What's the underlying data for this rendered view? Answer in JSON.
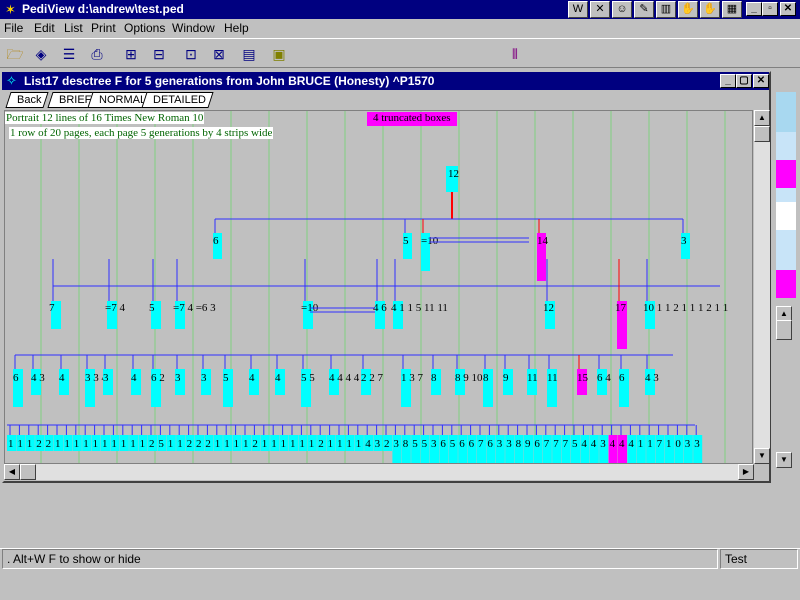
{
  "app": {
    "title": "PediView d:\\andrew\\test.ped"
  },
  "title_icons": [
    "W",
    "✕",
    "☺",
    "✎",
    "▥",
    "✋",
    "✋",
    "▦"
  ],
  "menu": [
    "File",
    "Edit",
    "List",
    "Print",
    "Options",
    "Window",
    "Help"
  ],
  "menu_mnemonics": [
    "F",
    "E",
    "L",
    "P",
    "O",
    "W",
    "H"
  ],
  "toolbar_icons": [
    "open-folder-icon",
    "eraser-icon",
    "list-lines-icon",
    "printer-icon",
    "tree-grid-icon",
    "boxes-icon",
    "descendants-icon",
    "ancestors-icon",
    "export-icon",
    "chart-icon"
  ],
  "child": {
    "title": "List17 desctree F for 5 generations from John BRUCE (Honesty) ^P1570"
  },
  "tabs": [
    "Back",
    "BRIEF",
    "NORMAL",
    "DETAILED"
  ],
  "info": {
    "line1": "Portrait  12 lines of 16   Times New Roman 10",
    "line2": " 1 row of 20 pages, each page  5 generations by  4 strips wide",
    "truncated": "4 truncated boxes"
  },
  "tree": {
    "root": "12",
    "gen2": [
      {
        "label": "6",
        "kind": "cyan"
      },
      {
        "label": "5",
        "kind": "cyan"
      },
      {
        "label": "=10",
        "kind": "cyan"
      },
      {
        "label": "14",
        "kind": "magenta"
      },
      {
        "label": "3",
        "kind": "cyan"
      }
    ],
    "gen3": [
      "7",
      "=7 4",
      "5",
      "=7 4 =6 3",
      "=10",
      "4 6",
      "4 1 1 5 11 11",
      "12",
      "17",
      "10 1 1 2 1 1 1 2 1 1"
    ],
    "gen4": [
      "6",
      "4 3",
      "4",
      "3 3 4",
      "3",
      "4",
      "6 2",
      "3",
      "3",
      "5",
      "4",
      "4",
      "5 5",
      "4 4 4 4 8:",
      "2 2 7",
      "1 3 7",
      "8",
      "8 9 10",
      "8",
      "9",
      "11",
      "11",
      "15",
      "6 4"
    ],
    "gen5": "1 1 1 2 2 1 1 1 1 1 1 1 1 1 1 2 5 1 1 2 2 2 1 1 1 1 2 1 1 1 1 1 1 2 1 1 1 1 4 3 2 3 8 5 5 3 6 5 6 6 7 6 3 3 8 9 6 7 7 7 5 4 4 3 4 4 4 1 1 7 1 0 3 3"
  },
  "status": {
    "hint": ". Alt+W F to show or hide",
    "file": "Test"
  },
  "colors": {
    "title_bg": "#000080",
    "tree_line": "#3030ff",
    "cyan": "#00ffff",
    "magenta": "#ff00ff",
    "red": "#ff0000",
    "green_grid": "#7fd07f"
  }
}
